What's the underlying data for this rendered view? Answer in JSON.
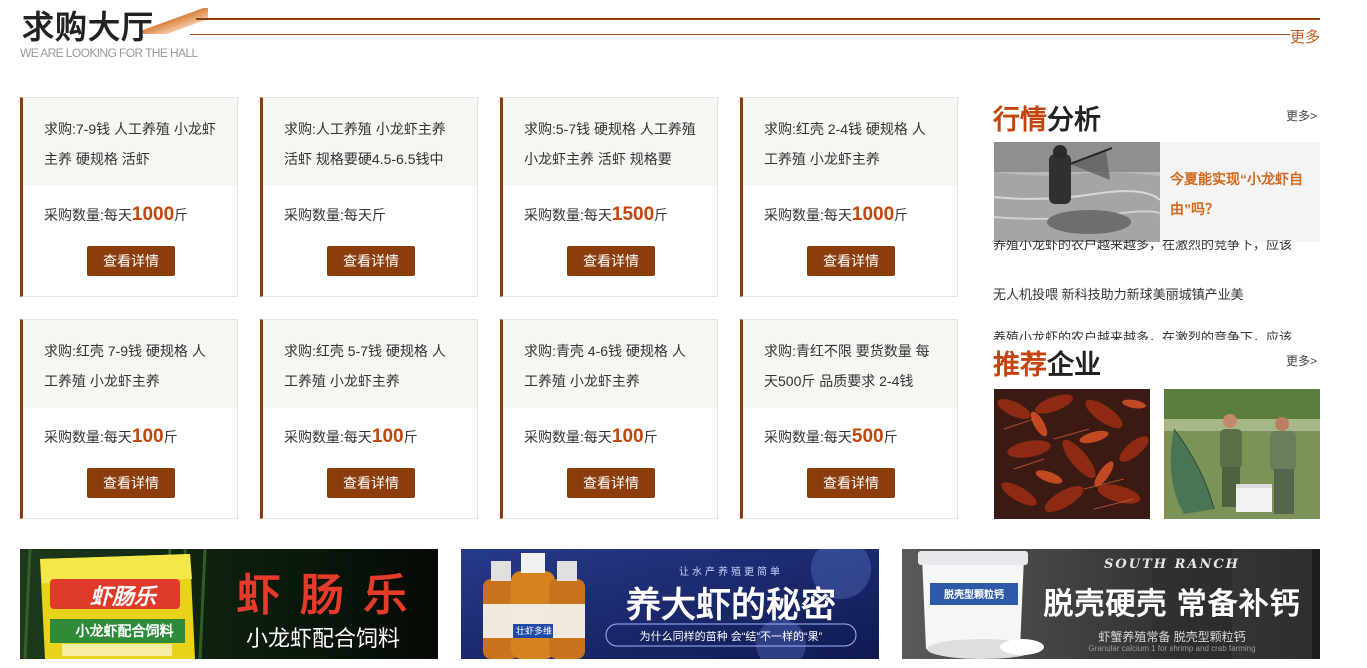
{
  "header": {
    "title": "求购大厅",
    "subtitle": "WE ARE LOOKING FOR THE HALL",
    "more": "更多"
  },
  "cards": [
    {
      "desc": "求购:7-9钱 人工养殖 小龙虾主养 硬规格 活虾",
      "qty_label": "采购数量:每天",
      "qty": "1000",
      "unit": "斤",
      "button": "查看详情"
    },
    {
      "desc": "求购:人工养殖 小龙虾主养活虾 规格要硬4.5-6.5钱中",
      "qty_label": "采购数量:每天斤",
      "qty": "",
      "unit": "",
      "button": "查看详情"
    },
    {
      "desc": "求购:5-7钱 硬规格 人工养殖 小龙虾主养 活虾 规格要",
      "qty_label": "采购数量:每天",
      "qty": "1500",
      "unit": "斤",
      "button": "查看详情"
    },
    {
      "desc": "求购:红壳 2-4钱 硬规格 人工养殖 小龙虾主养",
      "qty_label": "采购数量:每天",
      "qty": "1000",
      "unit": "斤",
      "button": "查看详情"
    },
    {
      "desc": "求购:红壳 7-9钱 硬规格 人工养殖 小龙虾主养",
      "qty_label": "采购数量:每天",
      "qty": "100",
      "unit": "斤",
      "button": "查看详情"
    },
    {
      "desc": "求购:红壳 5-7钱 硬规格 人工养殖 小龙虾主养",
      "qty_label": "采购数量:每天",
      "qty": "100",
      "unit": "斤",
      "button": "查看详情"
    },
    {
      "desc": "求购:青壳 4-6钱 硬规格 人工养殖 小龙虾主养",
      "qty_label": "采购数量:每天",
      "qty": "100",
      "unit": "斤",
      "button": "查看详情"
    },
    {
      "desc": "求购:青红不限 要货数量 每天500斤 品质要求 2-4钱",
      "qty_label": "采购数量:每天",
      "qty": "500",
      "unit": "斤",
      "button": "查看详情"
    }
  ],
  "market": {
    "title_hl": "行情",
    "title_rest": "分析",
    "more": "更多>",
    "feature_title": "今夏能实现“小龙虾自由”吗？",
    "news": [
      "养殖小龙虾的农户越来越多，在激烈的竞争下，应该",
      "无人机投喂 新科技助力新球美丽城镇产业美",
      "养殖小龙虾的农户越来越多，在激烈的竞争下，应该"
    ]
  },
  "recommend": {
    "title_hl": "推荐",
    "title_rest": "企业",
    "more": "更多>"
  },
  "banners": {
    "b1_brand": "虾肠乐",
    "b1_title": "虾 肠 乐",
    "b1_sub": "小龙虾配合饲料",
    "b1_bag": "小龙虾配合饲料",
    "b2_top": "让水产养殖更简单",
    "b2_title": "养大虾的秘密",
    "b2_sub": "为什么同样的苗种 会“结”不一样的“果”",
    "b2_bottle": "壮虾多维",
    "b3_top": "SOUTH RANCH",
    "b3_title": "脱壳硬壳 常备补钙",
    "b3_sub": "虾蟹养殖常备 脱壳型颗粒钙",
    "b3_sub2": "Granular calcium 1 for shrimp and crab farming",
    "b3_bucket": "脱壳型颗粒钙"
  }
}
